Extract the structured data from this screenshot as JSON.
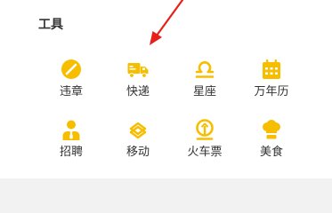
{
  "section": {
    "title": "工具"
  },
  "colors": {
    "icon": "#f7be00",
    "arrow": "#e8201a"
  },
  "tools": [
    {
      "label": "违章",
      "icon": "no-entry-icon"
    },
    {
      "label": "快递",
      "icon": "delivery-truck-icon"
    },
    {
      "label": "星座",
      "icon": "libra-icon"
    },
    {
      "label": "万年历",
      "icon": "calendar-icon"
    },
    {
      "label": "招聘",
      "icon": "recruit-person-icon"
    },
    {
      "label": "移动",
      "icon": "china-mobile-icon"
    },
    {
      "label": "火车票",
      "icon": "train-icon"
    },
    {
      "label": "美食",
      "icon": "chef-hat-icon"
    }
  ]
}
